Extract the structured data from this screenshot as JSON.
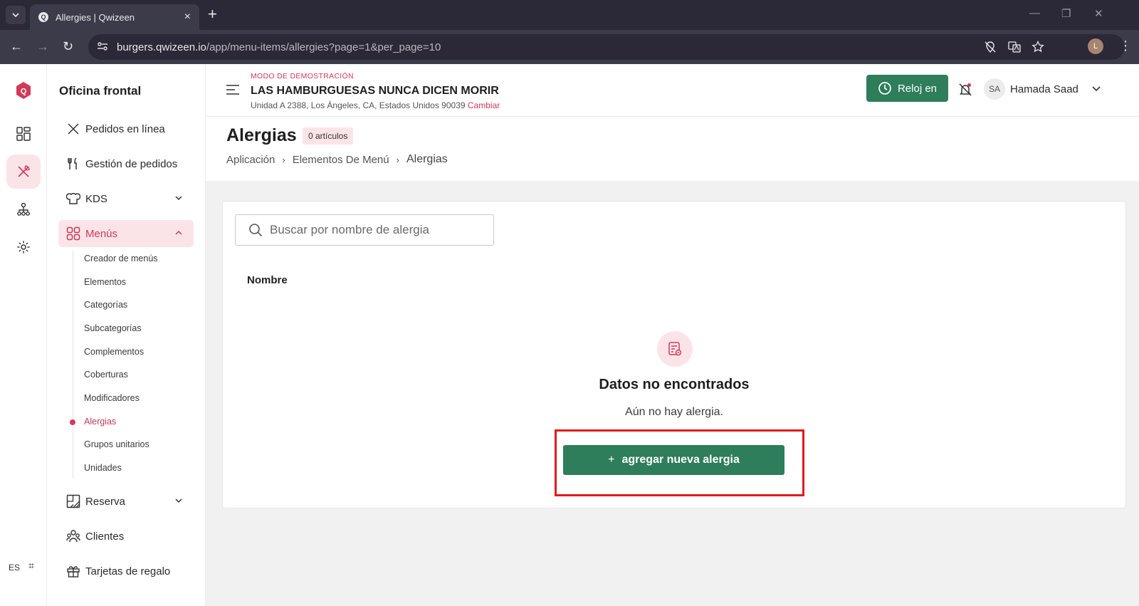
{
  "browser": {
    "tab_title": "Allergies | Qwizeen",
    "tab_favicon": "Q",
    "new_tab": "+",
    "url_host": "burgers.qwizeen.io",
    "url_path": "/app/menu-items/allergies?page=1&per_page=10",
    "profile_initial": "L"
  },
  "rail": {
    "logo_letter": "Q",
    "language": "ES"
  },
  "sidebar": {
    "brand": "Oficina frontal",
    "items": [
      {
        "label": "Pedidos en línea"
      },
      {
        "label": "Gestión de pedidos"
      },
      {
        "label": "KDS"
      },
      {
        "label": "Menús"
      },
      {
        "label": "Reserva"
      },
      {
        "label": "Clientes"
      },
      {
        "label": "Tarjetas de regalo"
      }
    ],
    "submenu": [
      "Creador de menús",
      "Elementos",
      "Categorías",
      "Subcategorías",
      "Complementos",
      "Coberturas",
      "Modificadores",
      "Alergias",
      "Grupos unitarios",
      "Unidades"
    ]
  },
  "header": {
    "demo_mode": "MODO DE DEMOSTRACIÓN",
    "restaurant": "LAS HAMBURGUESAS NUNCA DICEN MORIR",
    "address": "Unidad A 2388, Los Ángeles, CA, Estados Unidos 90039",
    "change_link": "Cambiar",
    "clock_in_label": "Reloj en",
    "user_initials": "SA",
    "user_name": "Hamada Saad"
  },
  "page": {
    "title": "Alergias",
    "count_badge": "0 artículos",
    "breadcrumb": [
      "Aplicación",
      "Elementos De Menú",
      "Alergias"
    ]
  },
  "content": {
    "search_placeholder": "Buscar por nombre de alergia",
    "column_name": "Nombre",
    "empty_title": "Datos no encontrados",
    "empty_subtitle": "Aún no hay alergia.",
    "add_button_plus": "+",
    "add_button_label": "agregar nueva alergia"
  },
  "colors": {
    "accent": "#d23a58",
    "primary_button": "#2e7d5b",
    "highlight_frame": "#e01b1b"
  }
}
